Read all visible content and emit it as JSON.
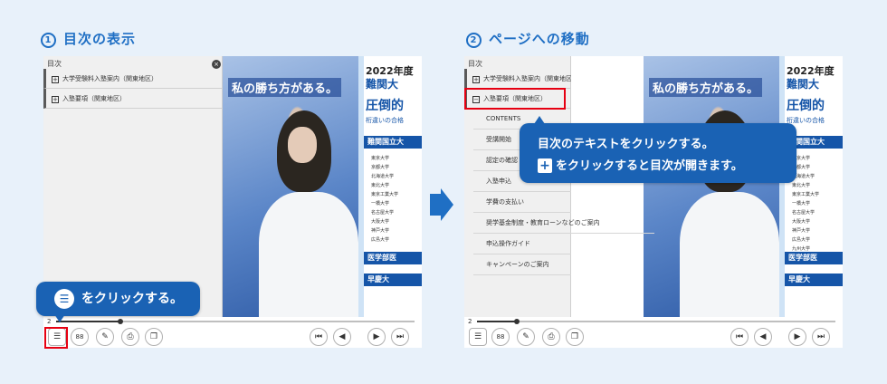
{
  "steps": {
    "step1": {
      "number": "1",
      "title": "目次の表示"
    },
    "step2": {
      "number": "2",
      "title": "ページへの移動"
    }
  },
  "viewer": {
    "toc_title": "目次",
    "close_glyph": "×",
    "toc_items": [
      {
        "label": "大学受験料入塾案内（関東地区）",
        "toggle": "+"
      },
      {
        "label": "入塾要項（関東地区）",
        "toggle": "+"
      }
    ],
    "toc_items_expanded": [
      {
        "label": "大学受験料入塾案内（関東地区）",
        "toggle": "+"
      },
      {
        "label": "入塾要項（関東地区）",
        "toggle": "−"
      }
    ],
    "toc_subitems": [
      "CONTENTS",
      "受講開始",
      "認定の確認",
      "入塾申込",
      "学費の支払い",
      "奨学基金制度・教育ローンなどのご案内",
      "申込操作ガイド",
      "キャンペーンのご案内"
    ],
    "page_number": "2",
    "progress_fraction": 0.18,
    "progress_fraction_2": 0.11,
    "controls": {
      "toc_glyph": "☰",
      "thumbs_glyph": "88",
      "first_glyph": "⏮",
      "prev_glyph": "◀",
      "next_glyph": "▶",
      "last_glyph": "⏭"
    }
  },
  "book": {
    "slogan": "私の勝ち方がある。",
    "year_heading": "2022年度",
    "title": "難関大",
    "big": "圧倒的",
    "sub": "桁違いの合格",
    "bar1": "難関国立大",
    "bar2": "医学部医",
    "bar3": "早慶大",
    "universities": [
      "東京大学",
      "京都大学",
      "北海道大学",
      "東北大学",
      "東京工業大学",
      "一橋大学",
      "名古屋大学",
      "大阪大学",
      "神戸大学",
      "広島大学",
      "九州大学"
    ]
  },
  "callouts": {
    "c1_badge": "☰",
    "c1_text": "をクリックする。",
    "c2_line1": "目次のテキストをクリックする。",
    "c2_badge": "+",
    "c2_line2": "をクリックすると目次が開きます。"
  },
  "colors": {
    "accent": "#1f6fc4",
    "callout": "#1a62b4",
    "highlight": "#e60012"
  }
}
